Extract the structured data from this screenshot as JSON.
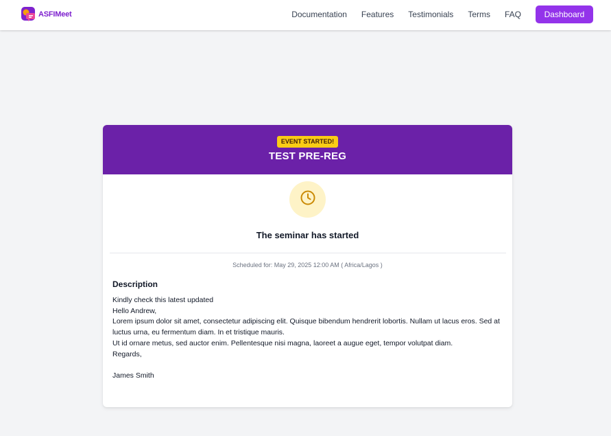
{
  "header": {
    "brand_name": "ASFIMeet",
    "nav": [
      {
        "label": "Documentation"
      },
      {
        "label": "Features"
      },
      {
        "label": "Testimonials"
      },
      {
        "label": "Terms"
      },
      {
        "label": "FAQ"
      }
    ],
    "dashboard_label": "Dashboard"
  },
  "event": {
    "badge": "EVENT STARTED!",
    "title": "TEST PRE-REG",
    "status": "The seminar has started",
    "scheduled": "Scheduled for: May 29, 2025 12:00 AM ( Africa/Lagos )",
    "description_heading": "Description",
    "description": {
      "line1": "Kindly check this latest updated",
      "line2": "Hello Andrew,",
      "line3": "Lorem ipsum dolor sit amet, consectetur adipiscing elit. Quisque bibendum hendrerit lobortis. Nullam ut lacus eros. Sed at luctus urna, eu fermentum diam. In et tristique mauris.",
      "line4": "Ut id ornare metus, sed auctor enim. Pellentesque nisi magna, laoreet a augue eget, tempor volutpat diam.",
      "line5": "Regards,",
      "line6": "James Smith"
    }
  },
  "colors": {
    "header_purple": "#6b21a8",
    "button_purple": "#9333ea",
    "badge_yellow": "#facc15",
    "clock_bg": "#fef3c7",
    "clock_stroke": "#ca8a04"
  },
  "icons": {
    "logo": "asfimeet-logo-icon",
    "status": "clock-icon"
  }
}
